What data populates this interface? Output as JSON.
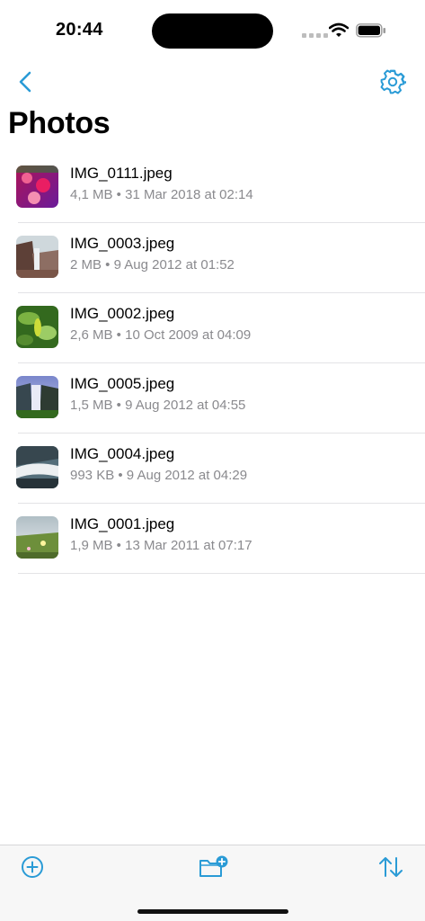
{
  "status_bar": {
    "time": "20:44"
  },
  "nav": {
    "back_icon": "chevron-left-icon",
    "settings_icon": "gear-icon",
    "accent": "#2a9bd6"
  },
  "title": "Photos",
  "files": [
    {
      "name": "IMG_0111.jpeg",
      "meta": "4,1 MB • 31 Mar 2018 at 02:14",
      "thumb_colors": [
        "#c2185b",
        "#7b1fa2"
      ]
    },
    {
      "name": "IMG_0003.jpeg",
      "meta": "2 MB • 9 Aug 2012 at 01:52",
      "thumb_colors": [
        "#6d4c41",
        "#a1887f"
      ]
    },
    {
      "name": "IMG_0002.jpeg",
      "meta": "2,6 MB • 10 Oct 2009 at 04:09",
      "thumb_colors": [
        "#558b2f",
        "#c0ca33"
      ]
    },
    {
      "name": "IMG_0005.jpeg",
      "meta": "1,5 MB • 9 Aug 2012 at 04:55",
      "thumb_colors": [
        "#5c6bc0",
        "#33691e"
      ]
    },
    {
      "name": "IMG_0004.jpeg",
      "meta": "993 KB • 9 Aug 2012 at 04:29",
      "thumb_colors": [
        "#455a64",
        "#eceff1"
      ]
    },
    {
      "name": "IMG_0001.jpeg",
      "meta": "1,9 MB • 13 Mar 2011 at 07:17",
      "thumb_colors": [
        "#90a4ae",
        "#689f38"
      ]
    }
  ],
  "toolbar": {
    "add_icon": "plus-circle-icon",
    "new_folder_icon": "folder-plus-icon",
    "sort_icon": "sort-arrows-icon"
  }
}
